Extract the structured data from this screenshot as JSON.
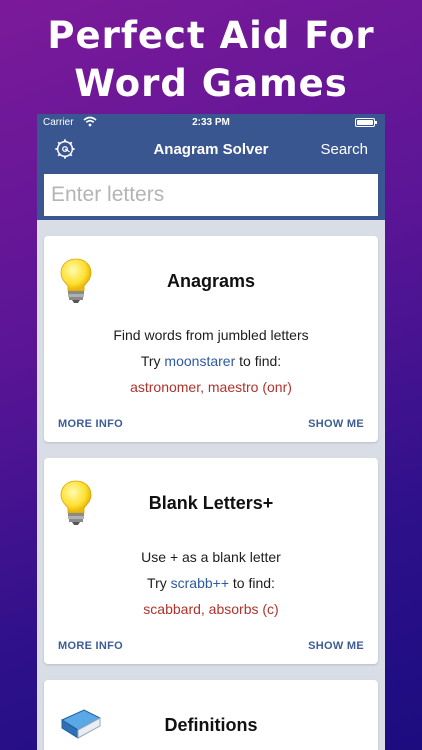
{
  "promo": {
    "headline_line1": "Perfect Aid For",
    "headline_line2": "Word Games"
  },
  "status_bar": {
    "carrier": "Carrier",
    "time": "2:33 PM"
  },
  "navbar": {
    "title": "Anagram Solver",
    "search_label": "Search",
    "settings_icon": "gear-icon"
  },
  "search": {
    "placeholder": "Enter letters",
    "value": ""
  },
  "colors": {
    "navbar": "#3a5691",
    "link": "#2d5aa0",
    "result": "#b0322b",
    "button": "#3d5c96"
  },
  "cards": [
    {
      "icon": "lightbulb-icon",
      "title": "Anagrams",
      "description": "Find words from jumbled letters",
      "try_prefix": "Try",
      "example": "moonstarer",
      "try_suffix": "to find:",
      "result": "astronomer, maestro (onr)",
      "more_info_label": "MORE INFO",
      "show_me_label": "SHOW ME"
    },
    {
      "icon": "lightbulb-icon",
      "title": "Blank Letters+",
      "description": "Use + as a blank letter",
      "try_prefix": "Try",
      "example": "scrabb++",
      "try_suffix": "to find:",
      "result": "scabbard, absorbs (c)",
      "more_info_label": "MORE INFO",
      "show_me_label": "SHOW ME"
    },
    {
      "icon": "dictionary-book-icon",
      "title": "Definitions"
    }
  ]
}
